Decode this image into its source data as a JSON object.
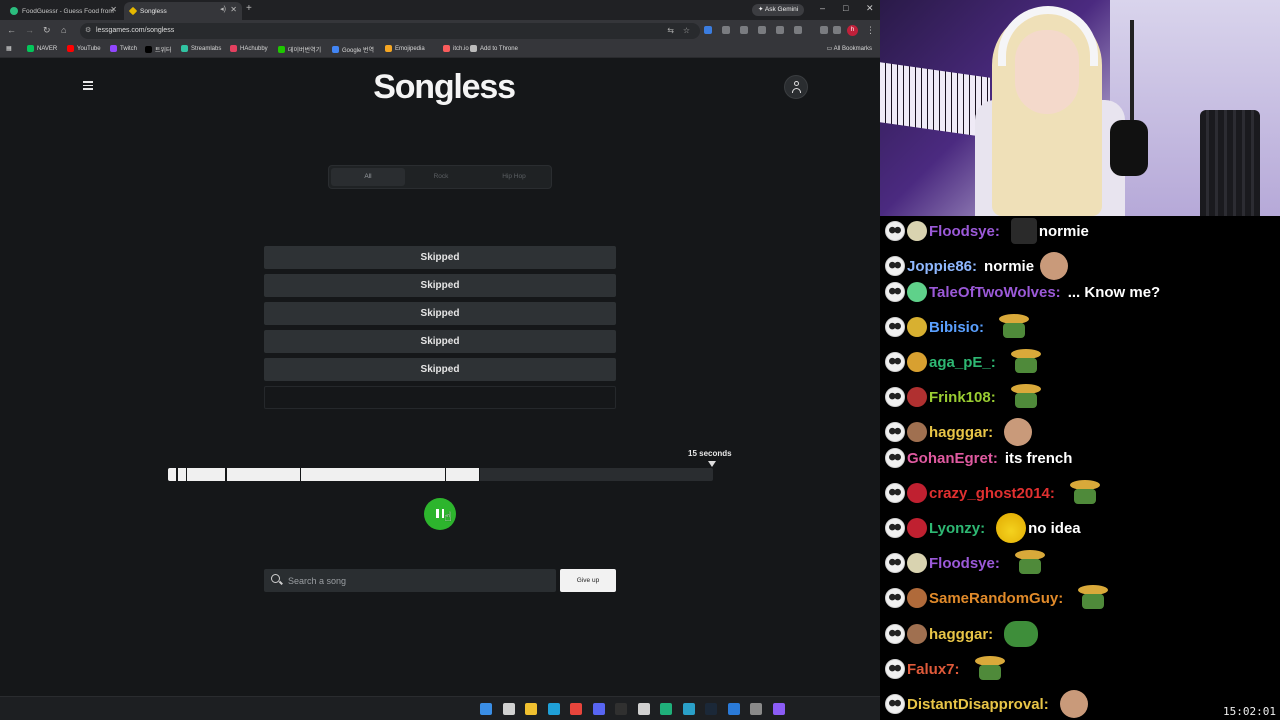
{
  "browser": {
    "tabs": [
      {
        "title": "FoodGuessr - Guess Food from"
      },
      {
        "title": "Songless"
      }
    ],
    "ask_gemini": "Ask Gemini",
    "url": "lessgames.com/songless",
    "bookmarks": [
      {
        "label": "NAVER",
        "color": "#03c75a"
      },
      {
        "label": "YouTube",
        "color": "#ff0000"
      },
      {
        "label": "Twitch",
        "color": "#9146ff"
      },
      {
        "label": "트위터",
        "color": "#000000"
      },
      {
        "label": "Streamlabs",
        "color": "#31c3a2"
      },
      {
        "label": "HAchubby",
        "color": "#e4405f"
      },
      {
        "label": "데이버번역기",
        "color": "#1ec800"
      },
      {
        "label": "Google 번역",
        "color": "#4285f4"
      },
      {
        "label": "Emojipedia",
        "color": "#f5a623"
      },
      {
        "label": "itch.io",
        "color": "#fa5c5c"
      },
      {
        "label": "Add to Throne",
        "color": "#bbbbbb"
      }
    ],
    "all_bookmarks": "All Bookmarks",
    "profile_initial": "h"
  },
  "songless": {
    "logo": "Songless",
    "genre_tabs": [
      {
        "label": "All",
        "active": true
      },
      {
        "label": "Rock",
        "active": false
      },
      {
        "label": "Hip Hop",
        "active": false
      }
    ],
    "guesses": [
      "Skipped",
      "Skipped",
      "Skipped",
      "Skipped",
      "Skipped",
      ""
    ],
    "seconds_label": "15 seconds",
    "progress": {
      "played_fraction": 0.57,
      "segment_fractions": [
        0.015,
        0.033,
        0.105,
        0.242,
        0.508,
        0.57
      ]
    },
    "search": {
      "placeholder": "Search a song",
      "value": ""
    },
    "give_up_label": "Give up"
  },
  "taskbar": {
    "icons": [
      {
        "name": "start-icon",
        "color": "#3a8ee6"
      },
      {
        "name": "search-icon",
        "color": "#d0d0d0"
      },
      {
        "name": "file-explorer-icon",
        "color": "#f0c030"
      },
      {
        "name": "edge-icon",
        "color": "#1fa0d8"
      },
      {
        "name": "chrome-icon",
        "color": "#e8453c"
      },
      {
        "name": "discord-icon",
        "color": "#5865f2"
      },
      {
        "name": "obs-icon",
        "color": "#303030"
      },
      {
        "name": "app-icon",
        "color": "#d0d0d0"
      },
      {
        "name": "spreadsheet-icon",
        "color": "#1fb07a"
      },
      {
        "name": "cursor-app-icon",
        "color": "#2aa0c8"
      },
      {
        "name": "steam-icon",
        "color": "#1b2838"
      },
      {
        "name": "paint-icon",
        "color": "#2a7ad8"
      },
      {
        "name": "settings-icon",
        "color": "#8a8a8a"
      },
      {
        "name": "assistant-icon",
        "color": "#8b5cf6"
      }
    ]
  },
  "chat": {
    "messages": [
      {
        "user": "Floodsye:",
        "color": "#9b59d8",
        "badge2": "#d9d3b0",
        "message": "normie",
        "emote": "dark"
      },
      {
        "user": "Joppie86:",
        "color": "#8fb8ff",
        "badge2": "",
        "message": "normie",
        "emote": "face"
      },
      {
        "user": "TaleOfTwoWolves:",
        "color": "#9b59d8",
        "badge2": "#5fd18a",
        "message": "... Know me?",
        "emote": ""
      },
      {
        "user": "Bibisio:",
        "color": "#5aa0ff",
        "badge2": "#d8b030",
        "message": "",
        "emote": "sombrero"
      },
      {
        "user": "aga_pE_:",
        "color": "#2eb873",
        "badge2": "#d8a030",
        "message": "",
        "emote": "sombrero"
      },
      {
        "user": "Frink108:",
        "color": "#9acd32",
        "badge2": "#b03030",
        "message": "",
        "emote": "sombrero"
      },
      {
        "user": "hagggar:",
        "color": "#e8c547",
        "badge2": "#a07050",
        "message": "",
        "emote": "face"
      },
      {
        "user": "GohanEgret:",
        "color": "#e05aa0",
        "badge2": "",
        "message": "its french",
        "emote": ""
      },
      {
        "user": "crazy_ghost2014:",
        "color": "#e03030",
        "badge2": "#c02030",
        "message": "",
        "emote": "sombrero"
      },
      {
        "user": "Lyonzy:",
        "color": "#2eb873",
        "badge2": "#c02030",
        "message": "no idea",
        "emote": "cool"
      },
      {
        "user": "Floodsye:",
        "color": "#9b59d8",
        "badge2": "#d9d3b0",
        "message": "",
        "emote": "sombrero"
      },
      {
        "user": "SameRandomGuy:",
        "color": "#e08a2a",
        "badge2": "#b06a3a",
        "message": "",
        "emote": "sombrero"
      },
      {
        "user": "hagggar:",
        "color": "#e8c547",
        "badge2": "#a07050",
        "message": "",
        "emote": "pepe"
      },
      {
        "user": "Falux7:",
        "color": "#e05a3a",
        "badge2": "",
        "message": "",
        "emote": "sombrero"
      },
      {
        "user": "DistantDisapproval:",
        "color": "#e8c547",
        "badge2": "",
        "message": "",
        "emote": "face"
      }
    ],
    "clock": "15:02:01"
  }
}
